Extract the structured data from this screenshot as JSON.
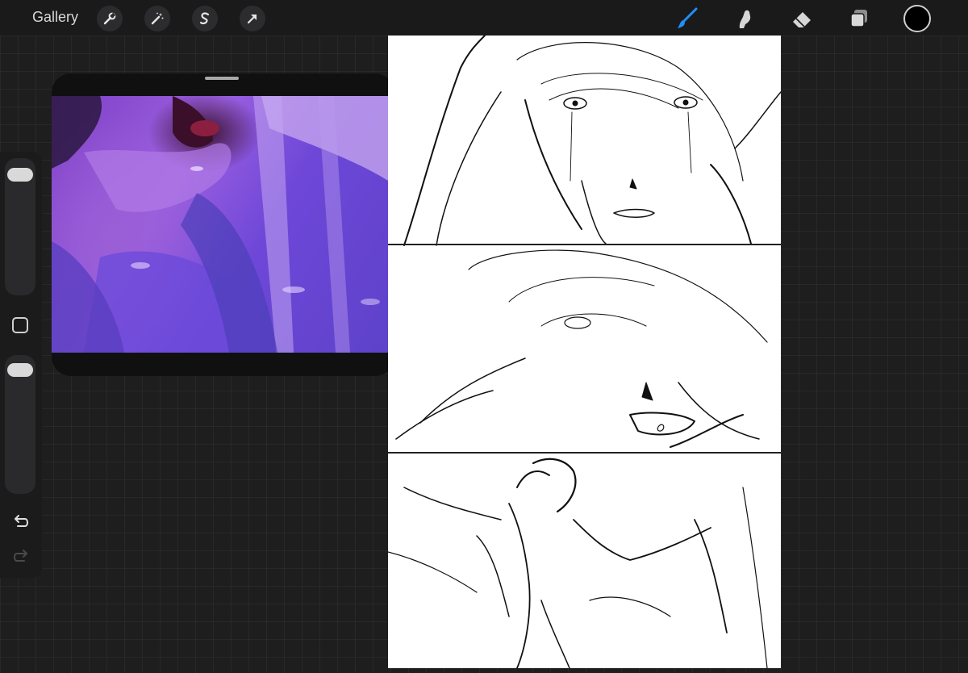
{
  "toolbar": {
    "gallery_label": "Gallery",
    "left_tools": [
      "wrench-icon",
      "magic-wand-icon",
      "selection-icon",
      "transform-arrow-icon"
    ],
    "right_tools": [
      "brush-icon",
      "smudge-icon",
      "eraser-icon",
      "layers-icon"
    ],
    "active_tool": "brush-icon",
    "accent_color": "#1f8fff",
    "current_color": "#000000"
  },
  "sidebar": {
    "brush_size_level": 0.12,
    "opacity_level": 0.05,
    "icons": [
      "modify-square-icon",
      "undo-arrow-icon",
      "redo-arrow-icon"
    ]
  },
  "reference_window": {
    "image": "purple-illustration-reference",
    "dominant_color": "#8a4fd6"
  },
  "canvas": {
    "background": "#ffffff",
    "panels": 3
  }
}
